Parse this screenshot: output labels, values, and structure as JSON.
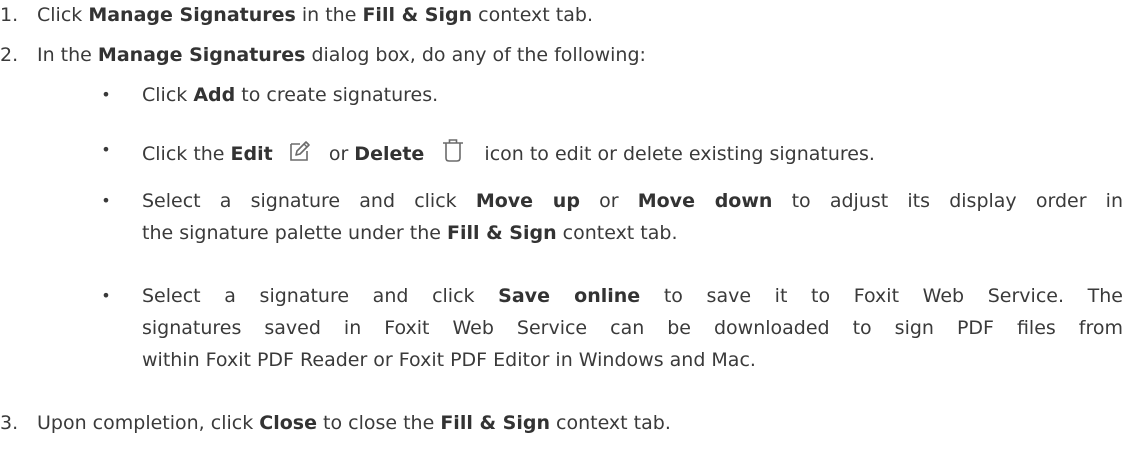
{
  "steps": [
    {
      "number": "1.",
      "parts": [
        "Click ",
        "Manage Signatures",
        " in the ",
        "Fill & Sign",
        " context tab."
      ]
    },
    {
      "number": "2.",
      "parts": [
        "In the ",
        "Manage Signatures",
        " dialog box, do any of the following:"
      ],
      "bullets": [
        {
          "parts": [
            "Click ",
            "Add",
            " to create signatures."
          ]
        },
        {
          "parts": [
            "Click the ",
            "Edit",
            " or ",
            "Delete",
            " icon to edit or delete existing signatures."
          ],
          "icons": [
            "edit-icon",
            "delete-icon"
          ]
        },
        {
          "line1": [
            "Select a signature and click ",
            "Move up",
            " or ",
            "Move down",
            " to adjust its display order in"
          ],
          "line2": [
            "the signature palette under the ",
            "Fill & Sign",
            " context tab."
          ]
        },
        {
          "line1": [
            "Select a signature and click ",
            "Save online",
            " to save it to Foxit Web Service. The"
          ],
          "line2": "signatures saved in Foxit Web Service can be downloaded to sign PDF files from",
          "line3": "within Foxit PDF Reader or Foxit PDF Editor in Windows and Mac."
        }
      ]
    },
    {
      "number": "3.",
      "parts": [
        "Upon completion, click ",
        "Close",
        " to close the ",
        "Fill & Sign",
        " context tab."
      ]
    }
  ],
  "bullet_symbol": "•",
  "colors": {
    "text": "#3a3a3a",
    "icon_stroke": "#6b6b6b"
  }
}
